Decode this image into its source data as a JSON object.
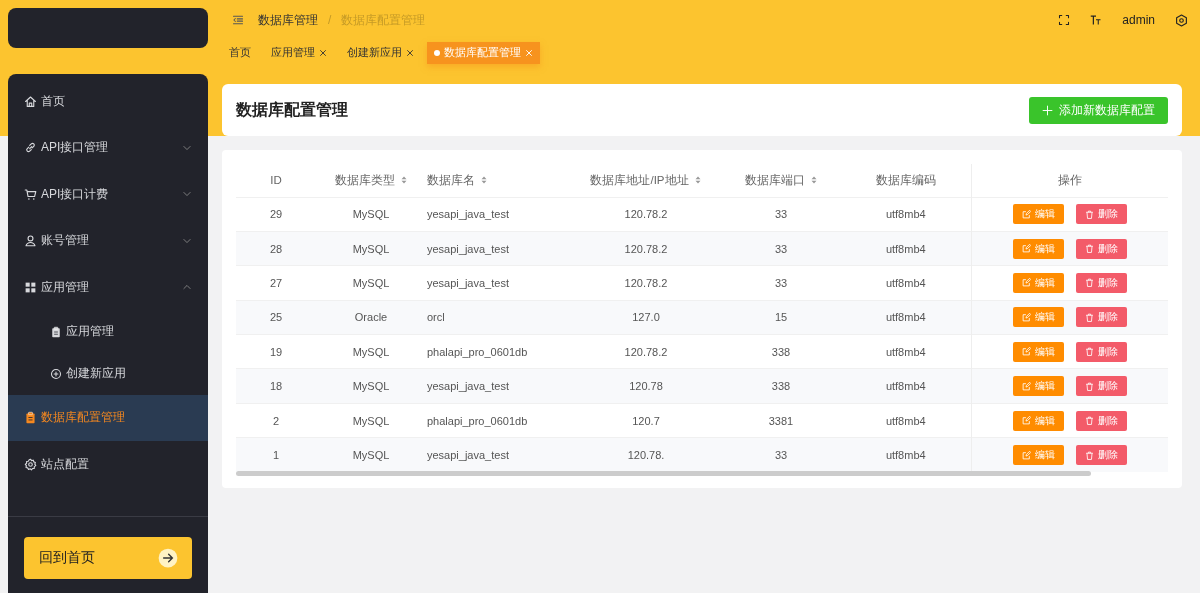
{
  "sidebar": {
    "items": [
      {
        "label": "首页",
        "selected": false
      },
      {
        "label": "API接口管理",
        "expanded": false,
        "selected": false
      },
      {
        "label": "API接口计费",
        "expanded": false,
        "selected": false
      },
      {
        "label": "账号管理",
        "expanded": false,
        "selected": false
      },
      {
        "label": "应用管理",
        "expanded": true,
        "selected": false,
        "children": [
          {
            "label": "应用管理",
            "selected": false
          },
          {
            "label": "创建新应用",
            "selected": false
          }
        ]
      },
      {
        "label": "数据库配置管理",
        "selected": true
      },
      {
        "label": "站点配置",
        "selected": false
      }
    ],
    "home_button": "回到首页"
  },
  "breadcrumb": [
    "数据库管理",
    "/",
    "数据库配置管理"
  ],
  "header_user": "admin",
  "tabs": [
    {
      "label": "首页",
      "closable": false,
      "selected": false
    },
    {
      "label": "应用管理",
      "closable": true,
      "selected": false
    },
    {
      "label": "创建新应用",
      "closable": true,
      "selected": false
    },
    {
      "label": "数据库配置管理",
      "closable": true,
      "selected": true
    }
  ],
  "page_title": "数据库配置管理",
  "add_button": "添加新数据库配置",
  "table": {
    "columns": [
      {
        "label": "ID",
        "sortable": false
      },
      {
        "label": "数据库类型",
        "sortable": true
      },
      {
        "label": "数据库名",
        "sortable": true
      },
      {
        "label": "数据库地址/IP地址",
        "sortable": true
      },
      {
        "label": "数据库端口",
        "sortable": true
      },
      {
        "label": "数据库编码",
        "sortable": false
      },
      {
        "label": "操作",
        "sortable": false
      }
    ],
    "rows": [
      {
        "cells": [
          "29",
          "MySQL",
          "yesapi_java_test",
          "120.78.2",
          "33",
          "utf8mb4"
        ],
        "actions": [
          "编辑",
          "删除"
        ]
      },
      {
        "cells": [
          "28",
          "MySQL",
          "yesapi_java_test",
          "120.78.2",
          "33",
          "utf8mb4"
        ],
        "actions": [
          "编辑",
          "删除"
        ]
      },
      {
        "cells": [
          "27",
          "MySQL",
          "yesapi_java_test",
          "120.78.2",
          "33",
          "utf8mb4"
        ],
        "actions": [
          "编辑",
          "删除"
        ]
      },
      {
        "cells": [
          "25",
          "Oracle",
          "orcl",
          "127.0",
          "15",
          "utf8mb4"
        ],
        "actions": [
          "编辑",
          "删除"
        ]
      },
      {
        "cells": [
          "19",
          "MySQL",
          "phalapi_pro_0601db",
          "120.78.2",
          "338",
          "utf8mb4"
        ],
        "actions": [
          "编辑",
          "删除"
        ]
      },
      {
        "cells": [
          "18",
          "MySQL",
          "yesapi_java_test",
          "120.78",
          "338",
          "utf8mb4"
        ],
        "actions": [
          "编辑",
          "删除"
        ]
      },
      {
        "cells": [
          "2",
          "MySQL",
          "phalapi_pro_0601db",
          "120.7",
          "3381",
          "utf8mb4"
        ],
        "actions": [
          "编辑",
          "删除"
        ]
      },
      {
        "cells": [
          "1",
          "MySQL",
          "yesapi_java_test",
          "120.78.",
          "33",
          "utf8mb4"
        ],
        "actions": [
          "编辑",
          "删除"
        ]
      }
    ]
  }
}
